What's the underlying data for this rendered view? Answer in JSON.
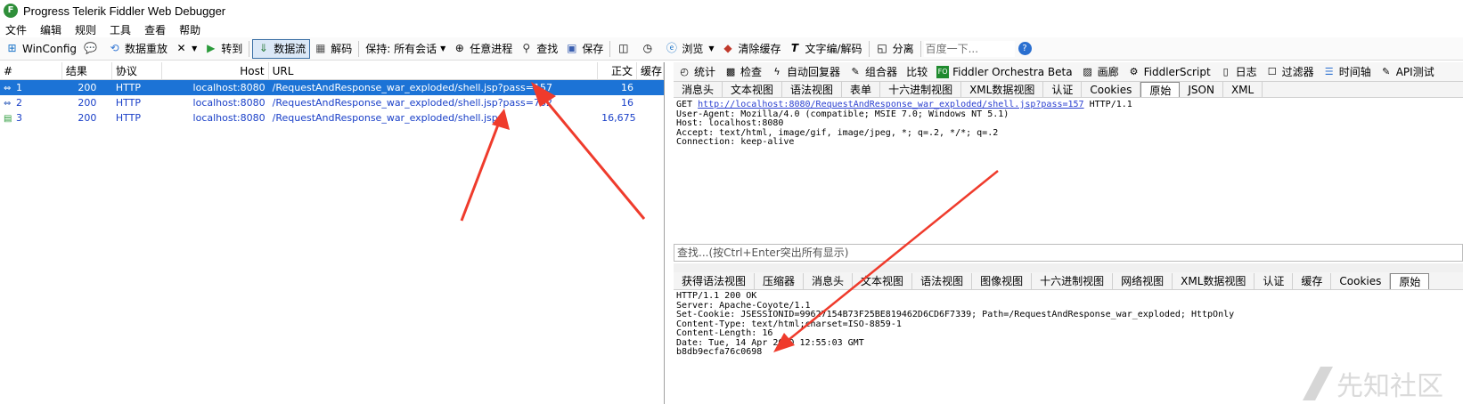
{
  "window": {
    "title": "Progress Telerik Fiddler Web Debugger"
  },
  "menu": [
    "文件",
    "编辑",
    "规则",
    "工具",
    "查看",
    "帮助"
  ],
  "toolbar": {
    "winconfig": "WinConfig",
    "replay": "数据重放",
    "go": "转到",
    "stream": "数据流",
    "decode": "解码",
    "keep_sessions": "保持: 所有会话",
    "any_process": "任意进程",
    "find": "查找",
    "save": "保存",
    "browse": "浏览",
    "clear_cache": "清除缓存",
    "text_encode": "文字编/解码",
    "tearoff": "分离",
    "search_placeholder": "百度一下..."
  },
  "session_list": {
    "columns": [
      "#",
      "结果",
      "协议",
      "Host",
      "URL",
      "正文",
      "缓存"
    ],
    "rows": [
      {
        "num": "1",
        "result": "200",
        "protocol": "HTTP",
        "host": "localhost:8080",
        "url": "/RequestAndResponse_war_exploded/shell.jsp?pass=157",
        "body": "16",
        "cache": ""
      },
      {
        "num": "2",
        "result": "200",
        "protocol": "HTTP",
        "host": "localhost:8080",
        "url": "/RequestAndResponse_war_exploded/shell.jsp?pass=702",
        "body": "16",
        "cache": ""
      },
      {
        "num": "3",
        "result": "200",
        "protocol": "HTTP",
        "host": "localhost:8080",
        "url": "/RequestAndResponse_war_exploded/shell.jsp",
        "body": "16,675",
        "cache": ""
      }
    ]
  },
  "inspector_tabs": [
    "统计",
    "检查",
    "自动回复器",
    "组合器",
    "比较",
    "Fiddler Orchestra Beta",
    "画廊",
    "FiddlerScript",
    "日志",
    "过滤器",
    "时间轴",
    "API测试"
  ],
  "request_tabs": [
    "消息头",
    "文本视图",
    "语法视图",
    "表单",
    "十六进制视图",
    "XML数据视图",
    "认证",
    "Cookies",
    "原始",
    "JSON",
    "XML"
  ],
  "request_active_tab": "原始",
  "request": {
    "method": "GET",
    "url": "http://localhost:8080/RequestAndResponse_war_exploded/shell.jsp?pass=157",
    "version": "HTTP/1.1",
    "headers": [
      "User-Agent: Mozilla/4.0 (compatible; MSIE 7.0; Windows NT 5.1)",
      "Host: localhost:8080",
      "Accept: text/html, image/gif, image/jpeg, *; q=.2, */*; q=.2",
      "Connection: keep-alive"
    ]
  },
  "find_bar": "查找...(按Ctrl+Enter突出所有显示)",
  "response_tabs": [
    "获得语法视图",
    "压缩器",
    "消息头",
    "文本视图",
    "语法视图",
    "图像视图",
    "十六进制视图",
    "网络视图",
    "XML数据视图",
    "认证",
    "缓存",
    "Cookies",
    "原始"
  ],
  "response_active_tab": "原始",
  "response": {
    "lines": [
      "HTTP/1.1 200 OK",
      "Server: Apache-Coyote/1.1",
      "Set-Cookie: JSESSIONID=99627154B73F25BE819462D6CD6F7339; Path=/RequestAndResponse_war_exploded; HttpOnly",
      "Content-Type: text/html;charset=ISO-8859-1",
      "Content-Length: 16",
      "Date: Tue, 14 Apr 2020 12:55:03 GMT",
      "",
      "b8db9ecfa76c0698"
    ]
  },
  "annotation_color": "#ef3b2c"
}
